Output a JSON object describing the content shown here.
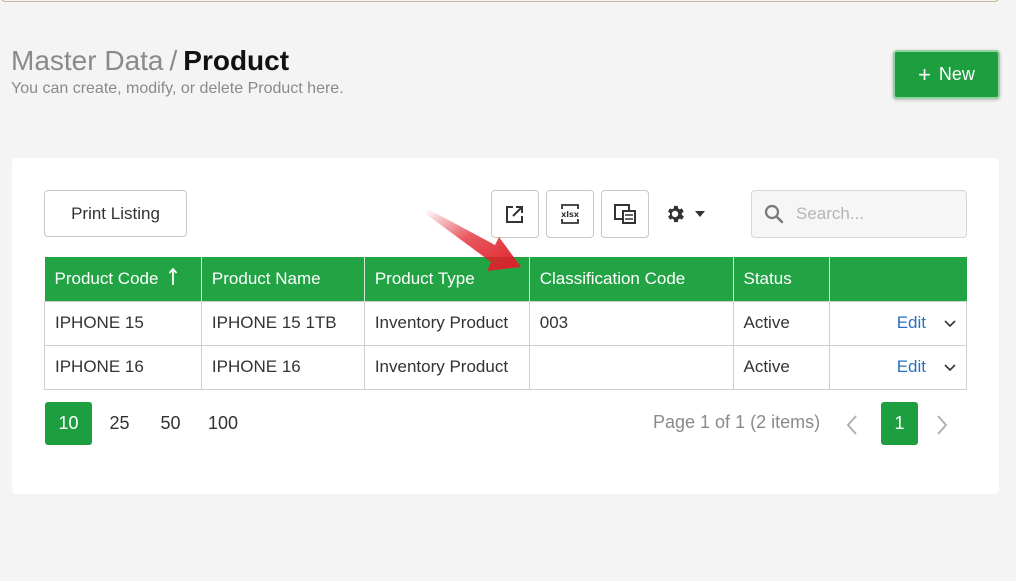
{
  "header": {
    "breadcrumb_parent": "Master Data",
    "separator": "/",
    "title": "Product",
    "subtitle": "You can create, modify, or delete Product here."
  },
  "actions": {
    "new_label": "New",
    "print_label": "Print Listing"
  },
  "toolbar": {
    "xlsx_label": "xlsx",
    "icons": [
      "export-icon",
      "xlsx-export-icon",
      "columns-icon",
      "gear-icon",
      "caret-down-icon",
      "search-icon"
    ]
  },
  "search": {
    "placeholder": "Search..."
  },
  "table": {
    "columns": [
      "Product Code",
      "Product Name",
      "Product Type",
      "Classification Code",
      "Status",
      ""
    ],
    "sorted_column": "Product Code",
    "sort_direction": "ascending",
    "rows": [
      {
        "code": "IPHONE 15",
        "name": "IPHONE 15 1TB",
        "type": "Inventory Product",
        "classification": "003",
        "status": "Active",
        "action": "Edit"
      },
      {
        "code": "IPHONE 16",
        "name": "IPHONE 16",
        "type": "Inventory Product",
        "classification": "",
        "status": "Active",
        "action": "Edit"
      }
    ]
  },
  "pagination": {
    "page_sizes": [
      "10",
      "25",
      "50",
      "100"
    ],
    "selected_size": "10",
    "info": "Page 1 of 1 (2 items)",
    "current_page": "1"
  },
  "colors": {
    "accent_green": "#22a445",
    "link_blue": "#2b6fc2",
    "annotation_red": "#e0202a"
  }
}
